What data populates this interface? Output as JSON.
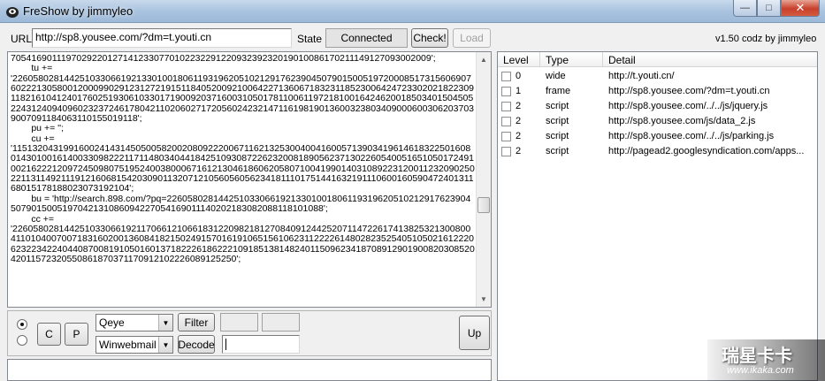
{
  "window": {
    "title": "FreShow by jimmyleo",
    "min_glyph": "—",
    "max_glyph": "□",
    "close_glyph": "✕"
  },
  "toolbar": {
    "url_label": "URL",
    "url_value": "http://sp8.yousee.com/?dm=t.youti.cn",
    "state_label": "State",
    "state_value": "Connected",
    "check_label": "Check!",
    "load_label": "Load",
    "version": "v1.50 codz by jimmyleo"
  },
  "code_lines": [
    "70541690111970292201271412330770102232291220932392320190100861702111491270930020​09';",
    "        tu +=",
    "'22605802814425103306619213301001806119319620510212917623904507901500519720008517315606907602221305800120009902912312721915118405200921006422713606718323118523006424723302021822309118216104124017602519306103301719009203716003105017811006119721810016424620018503401504505224312409409602323724617804211020602717205602423214711619819013600323803409000600306203703900709118406311015501​9118';",
    "        pu += '';",
    "        cu +=",
    "'11513204319916002414314505005820020809222006711621325300400416005713903419614618322501608014301001614003309822211711480340441842510930872262320081890562371302260540051651050172491002162221209724509807519524003800067161213046186062058071004199014031089223120011232090250221131149211191216068154203090113207121056056056234181110175144163219111060016059047240131168015178188023073192104';",
    "        bu = 'http://search.898.com/?pq=22605802814425103306619213301001806119319620510212917623904507901500519704213108609422705416901114020218308208811810108​8';",
    "        cc +=",
    "'2260580281442510330661921170661210661831220982181270840912442520711472261741382532130080041101040070071831602001360841821502491570161910651561062311222261480282352540510502161222062322342240440870081910501601371822261862221091851381482401150962341870891290190082030852042011572320550861870371170912102226089125250';"
  ],
  "list": {
    "headers": {
      "level": "Level",
      "type": "Type",
      "detail": "Detail"
    },
    "rows": [
      {
        "level": "0",
        "type": "wide",
        "detail": "http://t.youti.cn/"
      },
      {
        "level": "1",
        "type": "frame",
        "detail": "http://sp8.yousee.com/?dm=t.youti.cn"
      },
      {
        "level": "2",
        "type": "script",
        "detail": "http://sp8.yousee.com/../../js/jquery.js"
      },
      {
        "level": "2",
        "type": "script",
        "detail": "http://sp8.yousee.com/js/data_2.js"
      },
      {
        "level": "2",
        "type": "script",
        "detail": "http://sp8.yousee.com/../../js/parking.js"
      },
      {
        "level": "2",
        "type": "script",
        "detail": "http://pagead2.googlesyndication.com/apps..."
      }
    ]
  },
  "controls": {
    "c_label": "C",
    "p_label": "P",
    "combo1_value": "Qeye",
    "combo2_value": "Winwebmail",
    "filter_label": "Filter",
    "decode_label": "Decode",
    "up_label": "Up"
  },
  "watermark": {
    "main": "瑞星卡卡",
    "sub": "www.ikaka.com"
  },
  "colors": {
    "titlebar": "#a9c3df",
    "close_button": "#c7402b"
  }
}
